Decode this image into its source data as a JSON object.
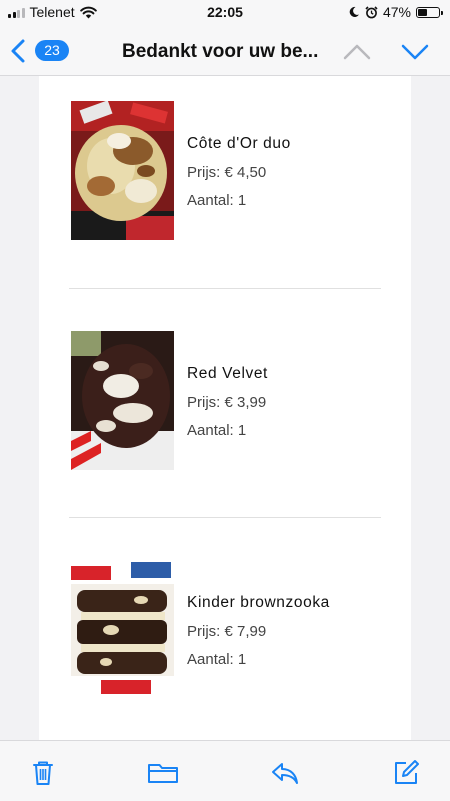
{
  "status_bar": {
    "carrier": "Telenet",
    "time": "22:05",
    "battery": "47%",
    "battery_level": 0.47
  },
  "nav": {
    "unread_count": "23",
    "title": "Bedankt voor uw be..."
  },
  "products": [
    {
      "name": "Côte d'Or duo",
      "price": "Prijs: € 4,50",
      "quantity": "Aantal: 1"
    },
    {
      "name": "Red Velvet",
      "price": "Prijs: € 3,99",
      "quantity": "Aantal: 1"
    },
    {
      "name": "Kinder brownzooka",
      "price": "Prijs: € 7,99",
      "quantity": "Aantal: 1"
    }
  ],
  "toolbar": {
    "icons": [
      "trash-icon",
      "folder-icon",
      "reply-icon",
      "compose-icon"
    ]
  },
  "colors": {
    "accent": "#1a84f5",
    "background": "#f2f2f4",
    "card": "#ffffff"
  }
}
